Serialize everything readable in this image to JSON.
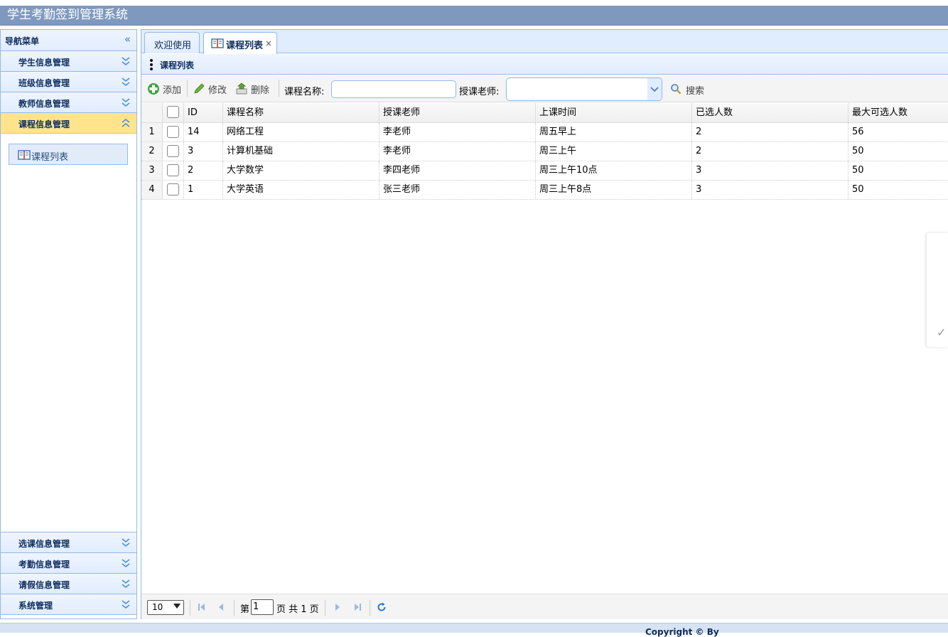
{
  "app": {
    "title": "学生考勤签到管理系统"
  },
  "sidebar": {
    "header": "导航菜单",
    "sections": [
      {
        "label": "学生信息管理"
      },
      {
        "label": "班级信息管理"
      },
      {
        "label": "教师信息管理"
      },
      {
        "label": "课程信息管理",
        "active": true,
        "items": [
          {
            "label": "课程列表",
            "icon": "book-icon"
          }
        ]
      },
      {
        "label": "选课信息管理"
      },
      {
        "label": "考勤信息管理"
      },
      {
        "label": "请假信息管理"
      },
      {
        "label": "系统管理"
      }
    ]
  },
  "tabs": [
    {
      "label": "欢迎使用"
    },
    {
      "label": "课程列表",
      "icon": "book-icon",
      "close": "×",
      "selected": true
    }
  ],
  "panel": {
    "title": "课程列表"
  },
  "toolbar": {
    "add": "添加",
    "edit": "修改",
    "delete": "删除",
    "course_name_label": "课程名称:",
    "course_name_value": "",
    "teacher_label": "授课老师:",
    "teacher_value": "",
    "search": "搜索"
  },
  "grid": {
    "columns": [
      "ID",
      "课程名称",
      "授课老师",
      "上课时间",
      "已选人数",
      "最大可选人数"
    ],
    "rows": [
      {
        "n": "1",
        "id": "14",
        "name": "网络工程",
        "teacher": "李老师",
        "time": "周五早上",
        "selected": "2",
        "max": "56"
      },
      {
        "n": "2",
        "id": "3",
        "name": "计算机基础",
        "teacher": "李老师",
        "time": "周三上午",
        "selected": "2",
        "max": "50"
      },
      {
        "n": "3",
        "id": "2",
        "name": "大学数学",
        "teacher": "李四老师",
        "time": "周三上午10点",
        "selected": "3",
        "max": "50"
      },
      {
        "n": "4",
        "id": "1",
        "name": "大学英语",
        "teacher": "张三老师",
        "time": "周三上午8点",
        "selected": "3",
        "max": "50"
      }
    ]
  },
  "pager": {
    "page_size": "10",
    "page_prefix": "第",
    "page_value": "1",
    "page_suffix": "页 共 1 页"
  },
  "footer": {
    "text": "Copyright © By"
  },
  "colors": {
    "header_bg": "#7f99be",
    "border": "#95b8e7",
    "active_section": "#ffe48d"
  }
}
